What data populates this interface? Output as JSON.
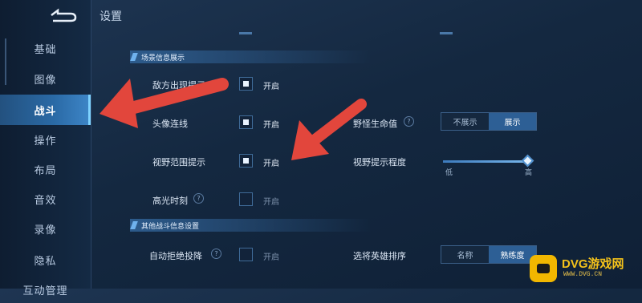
{
  "header": {
    "title": "设置"
  },
  "sidebar": {
    "items": [
      {
        "label": "基础"
      },
      {
        "label": "图像"
      },
      {
        "label": "战斗",
        "active": true
      },
      {
        "label": "操作"
      },
      {
        "label": "布局"
      },
      {
        "label": "音效"
      },
      {
        "label": "录像"
      },
      {
        "label": "隐私"
      },
      {
        "label": "互动管理"
      }
    ]
  },
  "sections": {
    "scene_info": "场景信息展示",
    "other_battle": "其他战斗信息设置"
  },
  "settings": {
    "enemy_appear": {
      "label": "敌方出现提示",
      "checked": true,
      "state": "开启"
    },
    "avatar_connect": {
      "label": "头像连线",
      "checked": true,
      "state": "开启"
    },
    "vision_range": {
      "label": "视野范围提示",
      "checked": true,
      "state": "开启"
    },
    "highlight": {
      "label": "高光时刻",
      "checked": false,
      "state": "开启"
    },
    "auto_refuse": {
      "label": "自动拒绝投降",
      "checked": false,
      "state": "开启"
    },
    "monster_hp": {
      "label": "野怪生命值",
      "options": [
        "不展示",
        "展示"
      ],
      "selected": "展示"
    },
    "vision_degree": {
      "label": "视野提示程度",
      "low": "低",
      "high": "高",
      "value_fraction": 1.0
    },
    "hero_sort": {
      "label": "选将英雄排序",
      "options": [
        "名称",
        "熟练度"
      ],
      "selected": "熟练度"
    }
  },
  "help_glyph": "?",
  "watermark": {
    "brand": "DVG游戏网",
    "url": "WWW.DVG.CN"
  },
  "colors": {
    "accent": "#2d5f95",
    "annotation_arrow": "#e2463c",
    "brand_yellow": "#f2b700"
  },
  "icons": {
    "back": "back-arrow-icon"
  }
}
